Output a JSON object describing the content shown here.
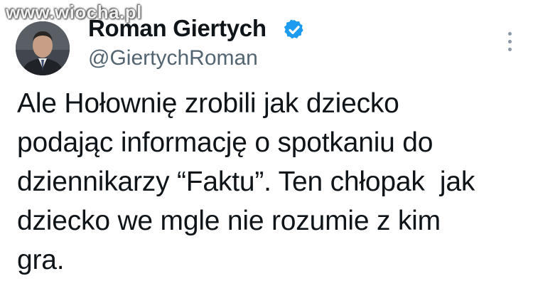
{
  "watermark": "www.wiocha.pl",
  "author": {
    "display_name": "Roman Giertych",
    "handle": "@GiertychRoman",
    "verified_icon": "verified-check-badge"
  },
  "tweet": {
    "text": "Ale Hołownię zrobili jak dziecko\npodając informację o spotkaniu do\ndziennikarzy “Faktu”. Ten chłopak  jak\ndziecko we mgle nie rozumie z kim\ngra."
  },
  "icons": {
    "more": "more-vertical-icon"
  },
  "colors": {
    "verified": "#1d9bf0",
    "handle": "#536471",
    "text": "#0f1419"
  }
}
